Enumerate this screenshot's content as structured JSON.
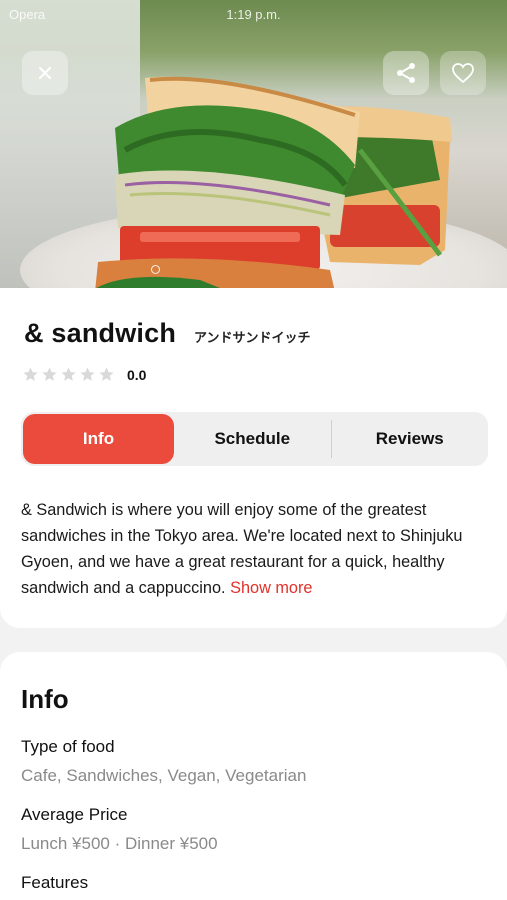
{
  "status_bar": {
    "carrier": "Opera",
    "time": "1:19 p.m."
  },
  "hero": {
    "page_indicator": "1"
  },
  "restaurant": {
    "name": "& sandwich",
    "name_jp": "アンドサンドイッチ",
    "rating": "0.0",
    "stars_filled": 0,
    "stars_total": 5
  },
  "tabs": [
    {
      "label": "Info",
      "active": true
    },
    {
      "label": "Schedule",
      "active": false
    },
    {
      "label": "Reviews",
      "active": false
    }
  ],
  "description": {
    "text": "& Sandwich is where you will enjoy some of the greatest sandwiches in the Tokyo area. We're located next to Shinjuku Gyoen, and we have a great restaurant for a quick, healthy sandwich and a cappuccino.",
    "show_more": "Show more"
  },
  "info": {
    "heading": "Info",
    "items": [
      {
        "label": "Type of food",
        "value": "Cafe, Sandwiches, Vegan, Vegetarian"
      },
      {
        "label": "Average Price",
        "value": "Lunch ¥500 · Dinner ¥500"
      },
      {
        "label": "Features",
        "value": ""
      }
    ]
  },
  "colors": {
    "accent": "#ea4b3c",
    "link": "#e0322a",
    "star_empty": "#d9d9d9"
  },
  "icons": {
    "close": "close-icon",
    "share": "share-icon",
    "favorite": "heart-icon"
  }
}
